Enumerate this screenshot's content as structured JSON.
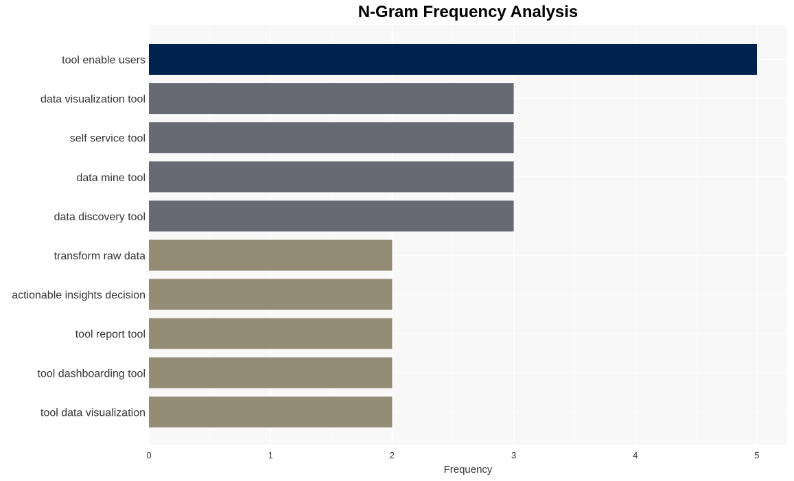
{
  "chart_data": {
    "type": "bar",
    "orientation": "horizontal",
    "title": "N-Gram Frequency Analysis",
    "xlabel": "Frequency",
    "ylabel": "",
    "xlim": [
      0,
      5.25
    ],
    "xticks": [
      0,
      1,
      2,
      3,
      4,
      5
    ],
    "grid": true,
    "categories": [
      "tool enable users",
      "data visualization tool",
      "self service tool",
      "data mine tool",
      "data discovery tool",
      "transform raw data",
      "actionable insights decision",
      "tool report tool",
      "tool dashboarding tool",
      "tool data visualization"
    ],
    "values": [
      5,
      3,
      3,
      3,
      3,
      2,
      2,
      2,
      2,
      2
    ],
    "colors": [
      "#00224e",
      "#676a73",
      "#676a73",
      "#676a73",
      "#676a73",
      "#948c75",
      "#948c75",
      "#948c75",
      "#948c75",
      "#948c75"
    ],
    "background": "#f8f8f8",
    "gridColor": "#ffffff"
  }
}
